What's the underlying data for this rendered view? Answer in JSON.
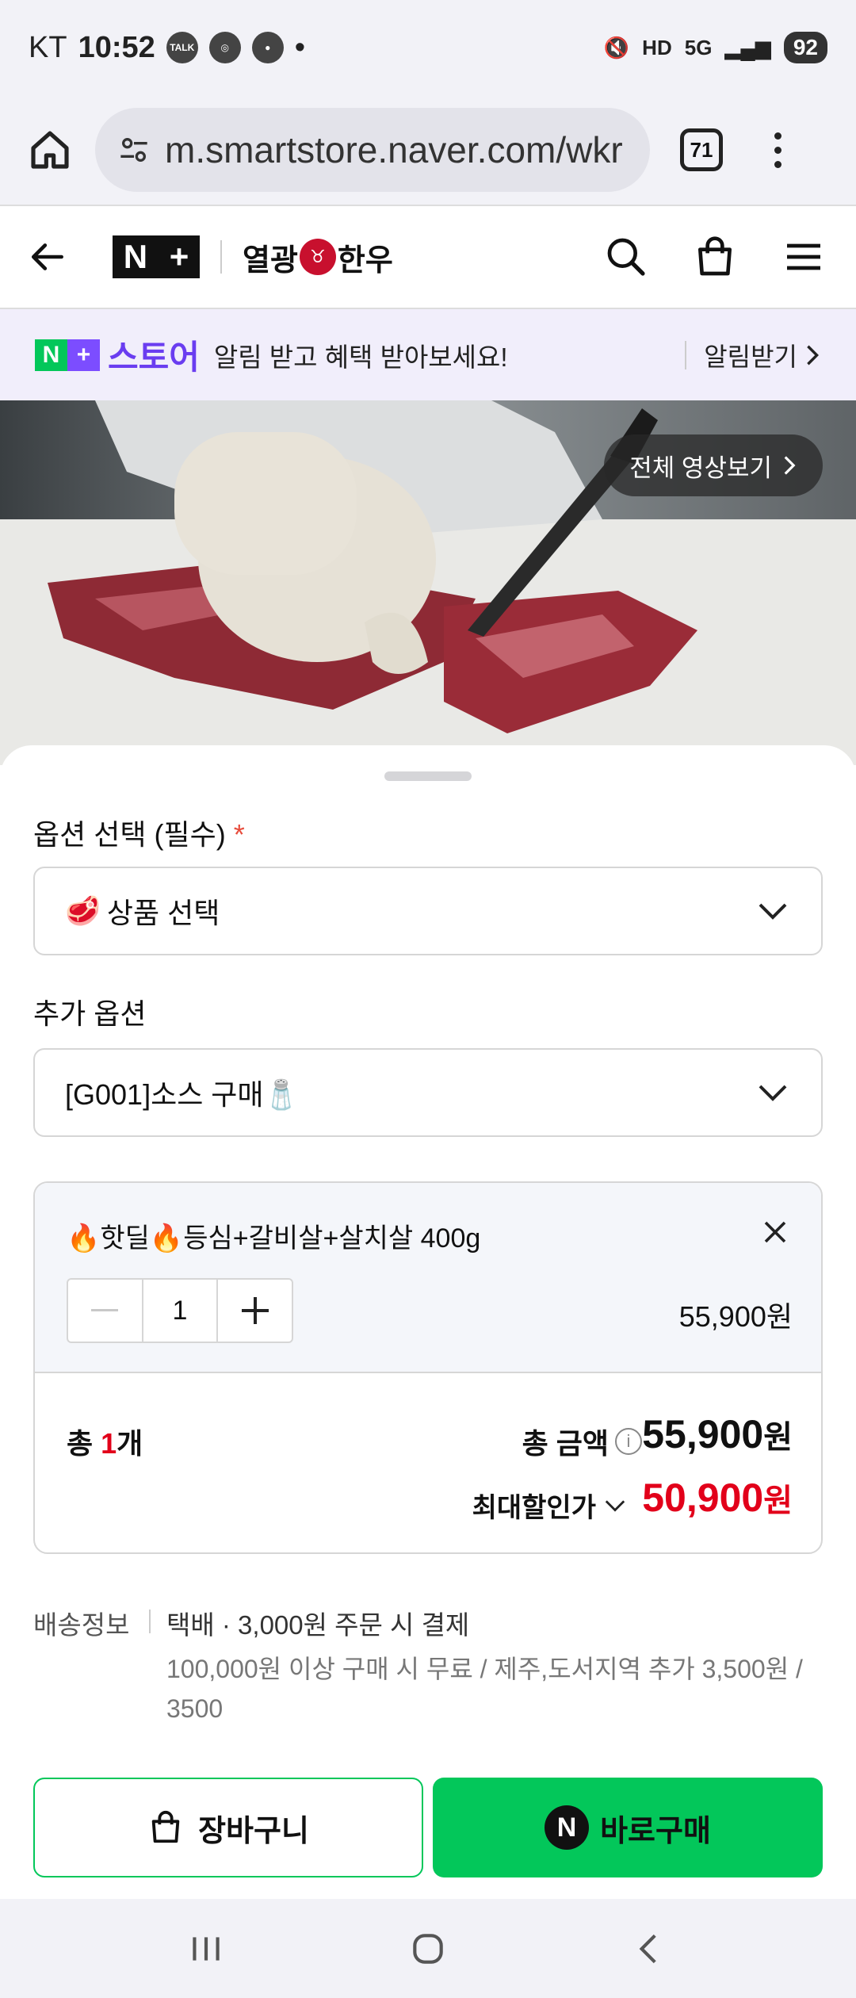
{
  "status_bar": {
    "carrier": "KT",
    "time": "10:52",
    "notif_icons": [
      "talk-icon",
      "app-icon",
      "chat-icon"
    ],
    "battery": "92"
  },
  "browser": {
    "url": "m.smartstore.naver.com/wkr",
    "tab_count": "71"
  },
  "store_header": {
    "brand_prefix": "열광",
    "brand_suffix": "한우"
  },
  "banner": {
    "store_label": "스토어",
    "message": "알림 받고 혜택 받아보세요!",
    "action": "알림받기"
  },
  "video": {
    "full_video_label": "전체 영상보기"
  },
  "options": {
    "required_label": "옵션 선택 (필수)",
    "required_mark": "*",
    "product_select_emoji": "🥩",
    "product_select_placeholder": "상품 선택",
    "extra_label": "추가 옵션",
    "extra_select_value": "[G001]소스 구매🧂"
  },
  "cart_item": {
    "title": "🔥핫딜🔥등심+갈비살+살치살 400g",
    "quantity": "1",
    "price": "55,900원"
  },
  "totals": {
    "count_prefix": "총 ",
    "count": "1",
    "count_suffix": "개",
    "amount_label": "총 금액",
    "amount": "55,900",
    "won": "원",
    "discount_label": "최대할인가",
    "discount_amount": "50,900"
  },
  "shipping": {
    "label": "배송정보",
    "main": "택배 · 3,000원 주문 시 결제",
    "sub": "100,000원 이상 구매 시 무료 / 제주,도서지역 추가 3,500원 / 3500"
  },
  "actions": {
    "cart_label": "장바구니",
    "buy_label": "바로구매"
  },
  "colors": {
    "naver_green": "#03c75a",
    "sale_red": "#e2001a",
    "nplus_purple": "#6a3df0"
  }
}
